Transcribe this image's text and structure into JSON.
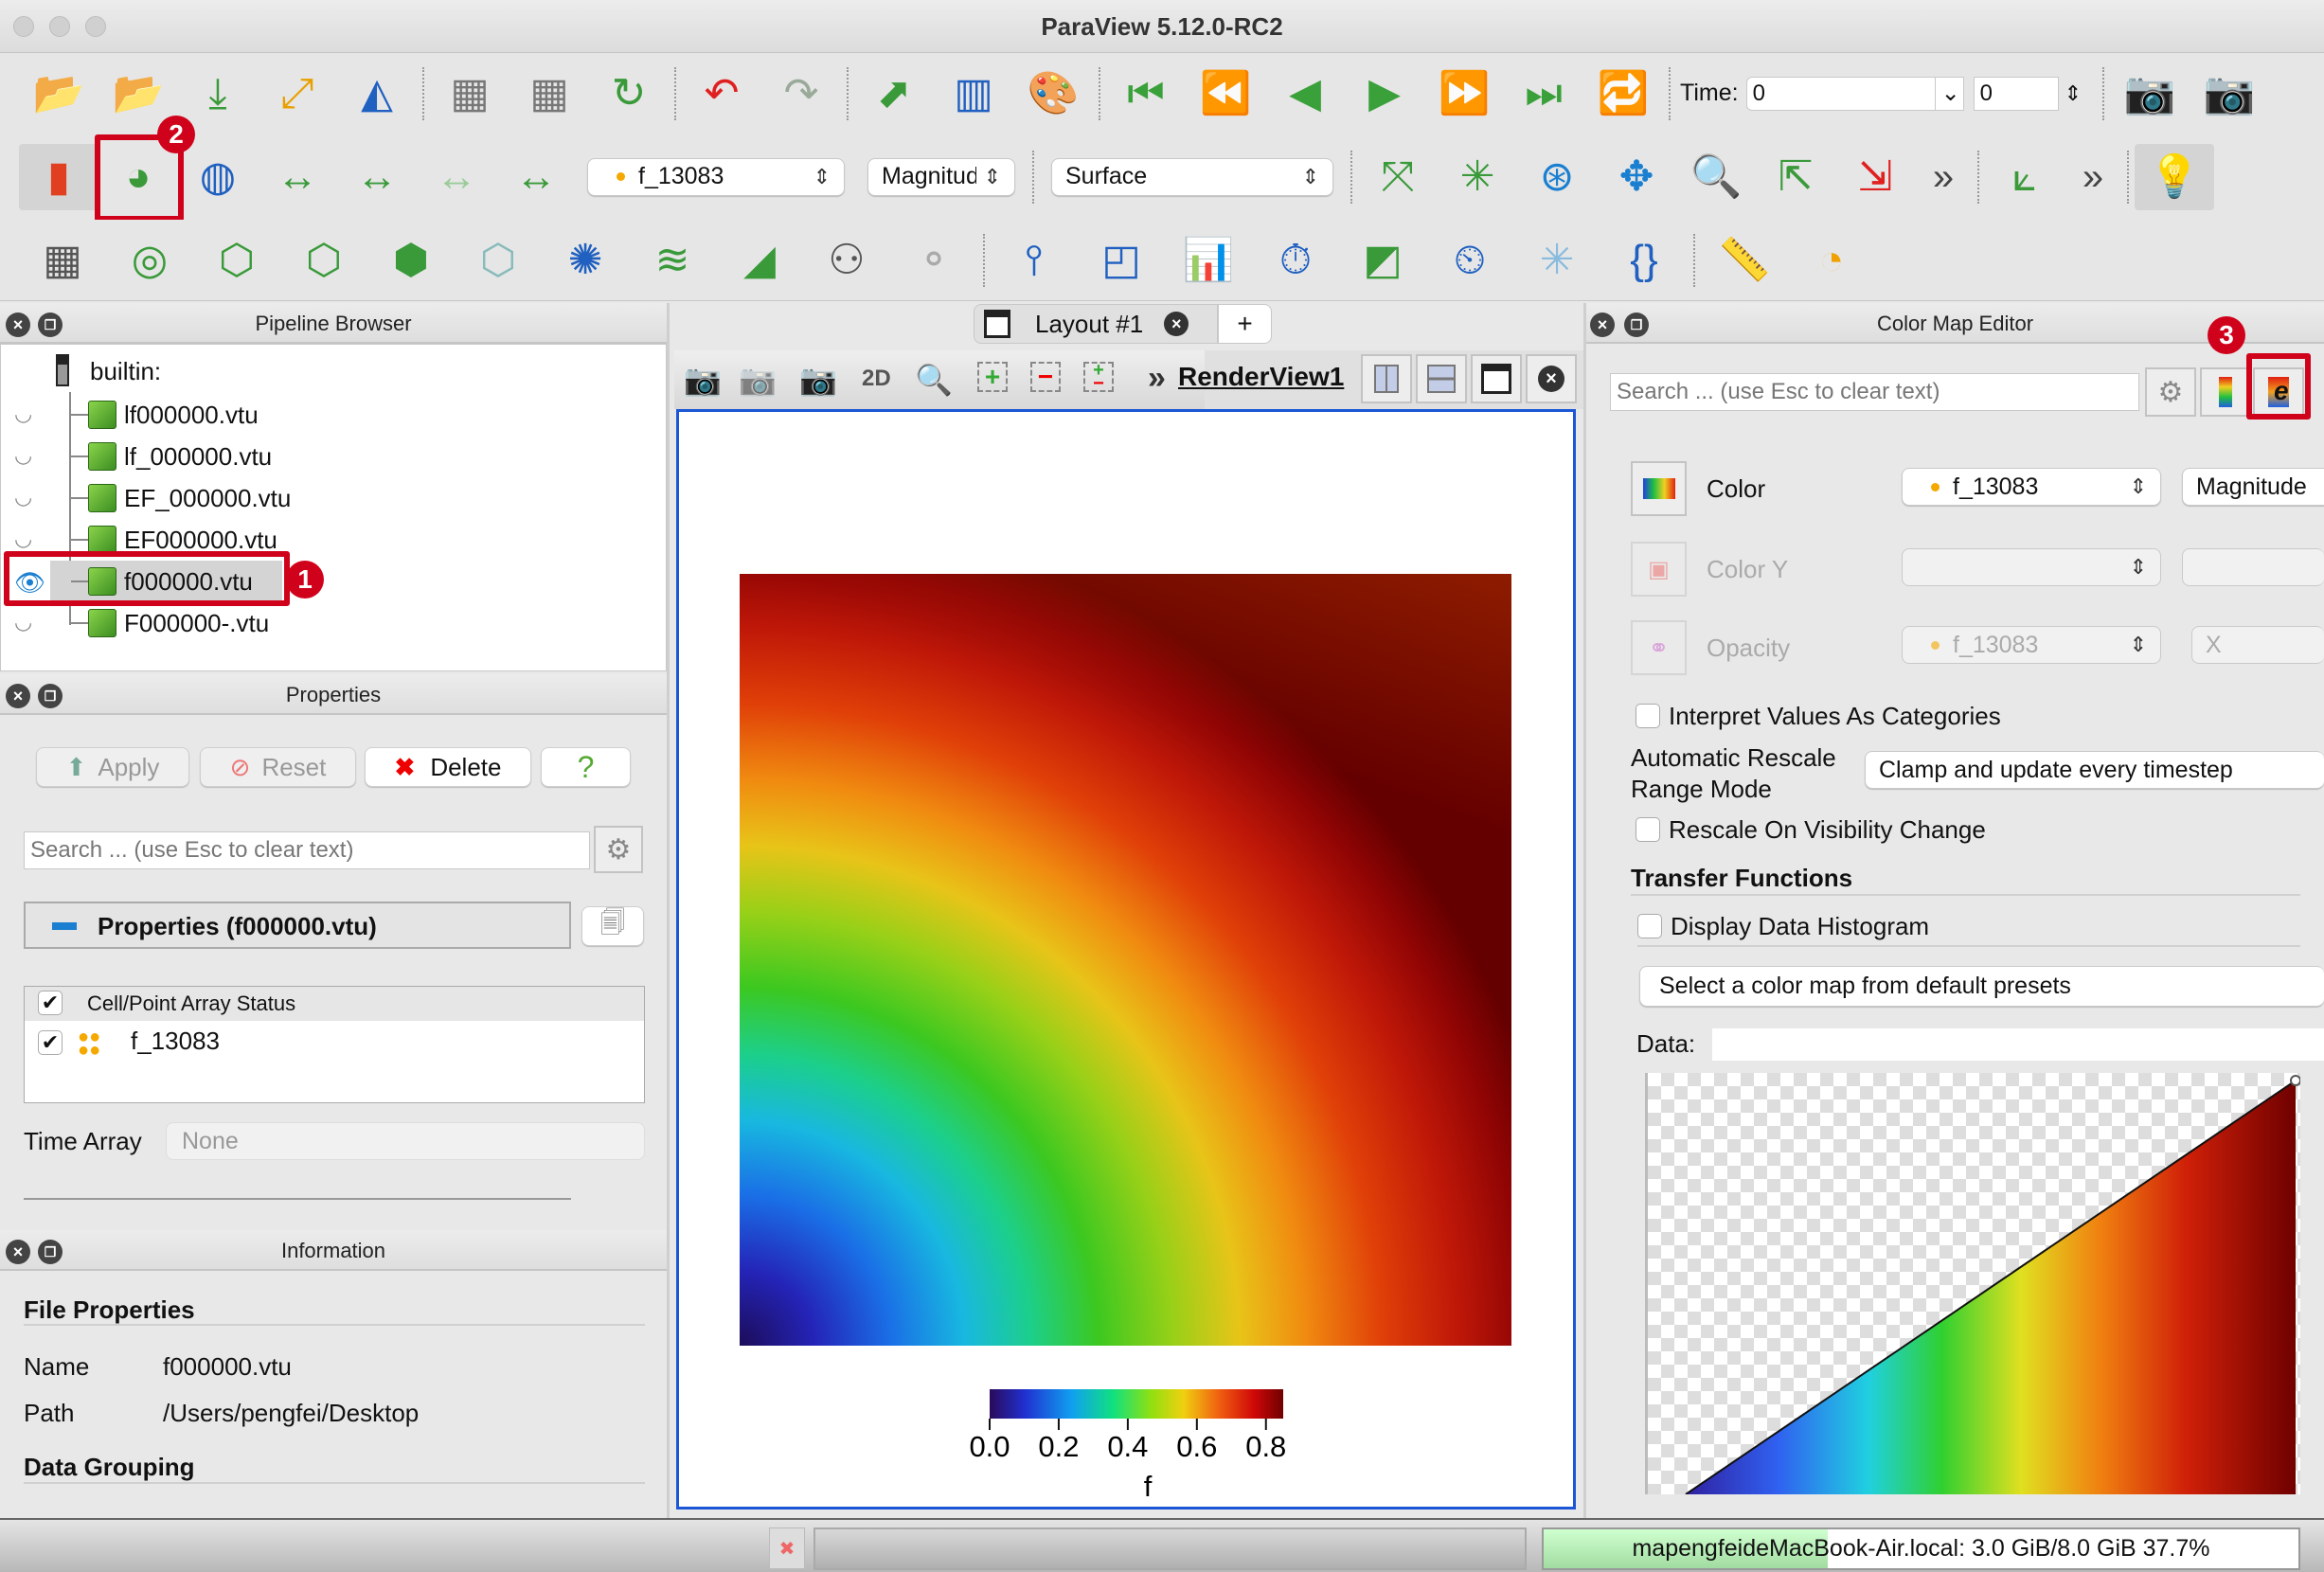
{
  "window": {
    "title": "ParaView 5.12.0-RC2"
  },
  "toolbar1": {
    "groups": [
      [
        "open-folder-icon",
        "open-recent-icon",
        "save-data-icon",
        "connect-icon",
        "disconnect-icon"
      ],
      [
        "save-state-icon",
        "load-state-icon",
        "reset-session-icon"
      ],
      [
        "undo-icon",
        "redo-icon"
      ],
      [
        "python-shell-icon",
        "macro-icon",
        "color-palette-icon"
      ],
      [
        "first-frame-icon",
        "previous-frame-icon",
        "play-backward-icon",
        "play-icon",
        "next-frame-icon",
        "last-frame-icon",
        "loop-icon"
      ]
    ],
    "time_label": "Time:",
    "time_value": "0",
    "timestep_value": "0",
    "end_icons": [
      "capture-camera-icon",
      "add-camera-icon"
    ]
  },
  "toolbar2": {
    "left_icons": [
      "color-legend-icon",
      "edit-color-map-icon",
      "reset-range-icon",
      "rescale-range-icon",
      "rescale-custom-icon",
      "rescale-temporal-icon",
      "rescale-visible-icon"
    ],
    "array_select": "f_13083",
    "component_select": "Magnitude",
    "representation_select": "Surface",
    "right_icons": [
      "reset-camera-icon",
      "zoom-to-data-icon",
      "view-x-icon",
      "view-y-icon",
      "zoom-box-icon",
      "plus-x-icon",
      "minus-x-icon"
    ],
    "more": "»",
    "extra_icons": [
      "axes-grid-icon"
    ],
    "more2": "»",
    "light_icon": "light-bulb-icon"
  },
  "toolbar3": {
    "groups": [
      [
        "calculator-icon",
        "contour-icon",
        "clip-icon",
        "slice-icon",
        "threshold-icon",
        "extract-subset-icon",
        "glyph-icon",
        "stream-tracer-icon",
        "warp-icon",
        "group-datasets-icon",
        "extract-level-icon"
      ],
      [
        "probe-line-icon",
        "select-points-icon",
        "histogram-icon",
        "plot-over-time-icon",
        "plot-over-line-icon",
        "plot-data-icon",
        "annotate-time-icon",
        "python-calc-icon"
      ],
      [
        "ruler-icon",
        "protractor-icon"
      ]
    ]
  },
  "pipeline": {
    "title": "Pipeline Browser",
    "root": "builtin:",
    "items": [
      {
        "name": "lf000000.vtu",
        "visible": false
      },
      {
        "name": "lf_000000.vtu",
        "visible": false
      },
      {
        "name": "EF_000000.vtu",
        "visible": false
      },
      {
        "name": "EF000000.vtu",
        "visible": false
      },
      {
        "name": "f000000.vtu",
        "visible": true,
        "selected": true
      },
      {
        "name": "F000000-.vtu",
        "visible": false
      }
    ]
  },
  "properties": {
    "title": "Properties",
    "apply": "Apply",
    "reset": "Reset",
    "delete": "Delete",
    "help": "?",
    "search_placeholder": "Search ... (use Esc to clear text)",
    "group_title": "Properties (f000000.vtu)",
    "array_header": "Cell/Point Array Status",
    "arrays": [
      {
        "name": "f_13083",
        "checked": true
      }
    ],
    "time_array_label": "Time Array",
    "time_array_value": "None"
  },
  "information": {
    "title": "Information",
    "file_properties": "File Properties",
    "name_label": "Name",
    "name_value": "f000000.vtu",
    "path_label": "Path",
    "path_value": "/Users/pengfei/Desktop",
    "data_grouping": "Data Grouping"
  },
  "layout": {
    "tab": "Layout #1",
    "add": "+"
  },
  "renderview": {
    "mode_2d": "2D",
    "more": "»",
    "name": "RenderView1",
    "border_color": "#1a56d6",
    "colorbar": {
      "title": "f",
      "ticks": [
        "0.0",
        "0.2",
        "0.4",
        "0.6",
        "0.8"
      ],
      "range": [
        0,
        0.85
      ]
    }
  },
  "colormap": {
    "title": "Color Map Editor",
    "search_placeholder": "Search ... (use Esc to clear text)",
    "color_label": "Color",
    "color_array": "f_13083",
    "color_component": "Magnitude",
    "colory_label": "Color Y",
    "opacity_label": "Opacity",
    "opacity_array": "f_13083",
    "opacity_component": "X",
    "interpret_categories": "Interpret Values As Categories",
    "auto_rescale_label1": "Automatic Rescale",
    "auto_rescale_label2": "Range Mode",
    "auto_rescale_value": "Clamp and update every timestep",
    "rescale_visibility": "Rescale On Visibility Change",
    "transfer_functions": "Transfer Functions",
    "display_histogram": "Display Data Histogram",
    "preset_button": "Select a color map from default presets",
    "data_label": "Data:"
  },
  "annotations": {
    "one": "1",
    "two": "2",
    "three": "3",
    "color": "#d0021b"
  },
  "statusbar": {
    "memory": "mapengfeideMacBook-Air.local: 3.0 GiB/8.0 GiB 37.7%",
    "memory_percent": 37.7
  }
}
